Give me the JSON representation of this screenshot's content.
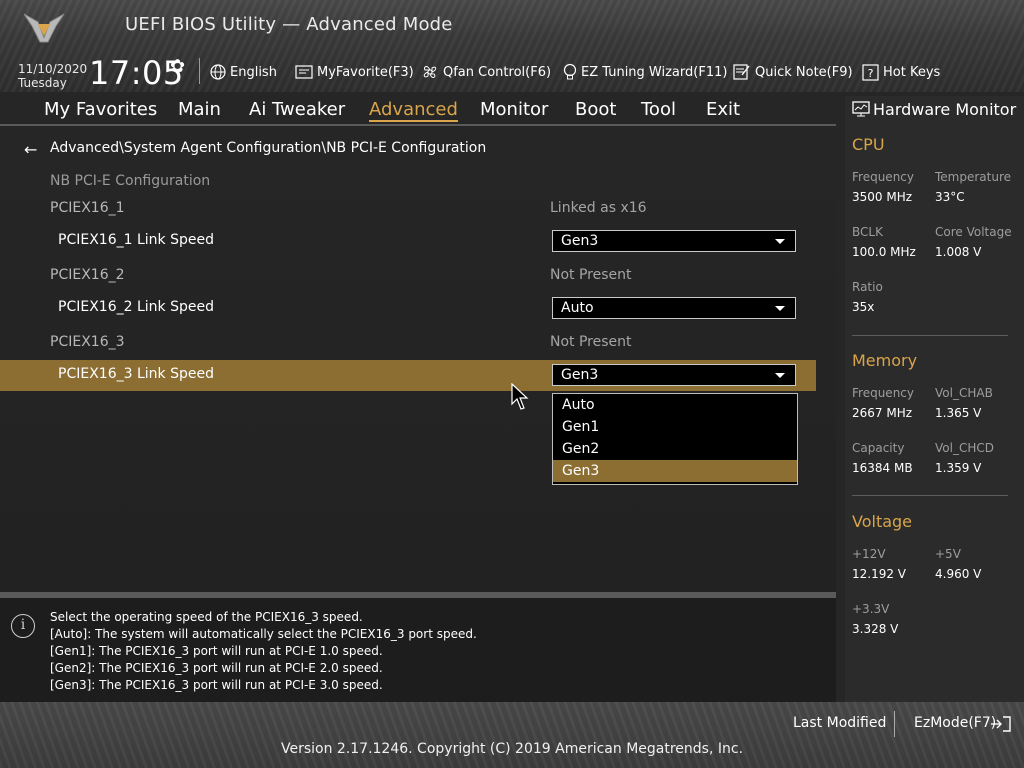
{
  "header": {
    "title": "UEFI BIOS Utility — Advanced Mode",
    "date": "11/10/2020",
    "day": "Tuesday",
    "time": "17:05"
  },
  "toolbar": {
    "language": "English",
    "favorite": "MyFavorite(F3)",
    "qfan": "Qfan Control(F6)",
    "ez_tuning": "EZ Tuning Wizard(F11)",
    "quick_note": "Quick Note(F9)",
    "hot_keys": "Hot Keys"
  },
  "tabs": [
    "My Favorites",
    "Main",
    "Ai Tweaker",
    "Advanced",
    "Monitor",
    "Boot",
    "Tool",
    "Exit"
  ],
  "active_tab": "Advanced",
  "breadcrumb": "Advanced\\System Agent Configuration\\NB PCI-E Configuration",
  "section_title": "NB PCI-E Configuration",
  "items": [
    {
      "label": "PCIEX16_1",
      "value": "Linked as x16",
      "setting_label": "PCIEX16_1 Link Speed",
      "setting_value": "Gen3"
    },
    {
      "label": "PCIEX16_2",
      "value": "Not Present",
      "setting_label": "PCIEX16_2 Link Speed",
      "setting_value": "Auto"
    },
    {
      "label": "PCIEX16_3",
      "value": "Not Present",
      "setting_label": "PCIEX16_3 Link Speed",
      "setting_value": "Gen3"
    }
  ],
  "dropdown": {
    "options": [
      "Auto",
      "Gen1",
      "Gen2",
      "Gen3"
    ],
    "selected": "Gen3"
  },
  "help": [
    "Select the operating speed of the PCIEX16_3 speed.",
    "[Auto]: The system will automatically select the PCIEX16_3 port speed.",
    "[Gen1]: The PCIEX16_3 port will run at PCI-E 1.0 speed.",
    "[Gen2]: The PCIEX16_3 port will run at PCI-E 2.0 speed.",
    "[Gen3]: The PCIEX16_3 port will run at PCI-E 3.0 speed."
  ],
  "hardware_monitor": {
    "title": "Hardware Monitor",
    "cpu": {
      "title": "CPU",
      "frequency_label": "Frequency",
      "frequency": "3500 MHz",
      "temperature_label": "Temperature",
      "temperature": "33°C",
      "bclk_label": "BCLK",
      "bclk": "100.0 MHz",
      "core_voltage_label": "Core Voltage",
      "core_voltage": "1.008 V",
      "ratio_label": "Ratio",
      "ratio": "35x"
    },
    "memory": {
      "title": "Memory",
      "frequency_label": "Frequency",
      "frequency": "2667 MHz",
      "vol_chab_label": "Vol_CHAB",
      "vol_chab": "1.365 V",
      "capacity_label": "Capacity",
      "capacity": "16384 MB",
      "vol_chcd_label": "Vol_CHCD",
      "vol_chcd": "1.359 V"
    },
    "voltage": {
      "title": "Voltage",
      "v12_label": "+12V",
      "v12": "12.192 V",
      "v5_label": "+5V",
      "v5": "4.960 V",
      "v33_label": "+3.3V",
      "v33": "3.328 V"
    }
  },
  "footer": {
    "last_modified": "Last Modified",
    "ezmode": "EzMode(F7)",
    "version": "Version 2.17.1246. Copyright (C) 2019 American Megatrends, Inc."
  },
  "colors": {
    "accent": "#d9a44a",
    "highlight": "#8c6e33"
  }
}
